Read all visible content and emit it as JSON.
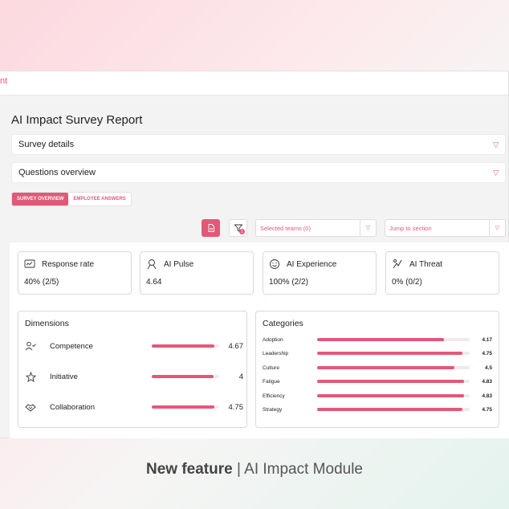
{
  "app": {
    "logo_text": "nt",
    "title": "AI Impact Survey Report"
  },
  "accordions": [
    {
      "label": "Survey details"
    },
    {
      "label": "Questions overview"
    }
  ],
  "tabs": [
    {
      "label": "SURVEY OVERVIEW",
      "active": true
    },
    {
      "label": "EMPLOYEE ANSWERS",
      "active": false
    }
  ],
  "toolbar": {
    "filter_badge": "1",
    "teams_select": "Selected teams (0)",
    "jump_select": "Jump to section"
  },
  "kpis": [
    {
      "label": "Response rate",
      "value": "40% (2/5)",
      "icon": "response-rate-icon"
    },
    {
      "label": "AI Pulse",
      "value": "4.64",
      "icon": "ai-pulse-icon"
    },
    {
      "label": "AI Experience",
      "value": "100% (2/2)",
      "icon": "smiley-icon"
    },
    {
      "label": "AI Threat",
      "value": "0% (0/2)",
      "icon": "ai-threat-icon"
    }
  ],
  "dimensions": {
    "title": "Dimensions",
    "items": [
      {
        "label": "Competence",
        "value": "4.67",
        "fraction": 0.93,
        "icon": "competence-icon"
      },
      {
        "label": "Initiative",
        "value": "4",
        "fraction": 0.92,
        "icon": "star-icon"
      },
      {
        "label": "Collaboration",
        "value": "4.75",
        "fraction": 0.93,
        "icon": "handshake-icon"
      }
    ]
  },
  "categories": {
    "title": "Categories",
    "items": [
      {
        "label": "Adoption",
        "value": "4.17",
        "fraction": 0.83
      },
      {
        "label": "Leadership",
        "value": "4.75",
        "fraction": 0.95
      },
      {
        "label": "Culture",
        "value": "4.5",
        "fraction": 0.9
      },
      {
        "label": "Fatigue",
        "value": "4.83",
        "fraction": 0.965
      },
      {
        "label": "Efficiency",
        "value": "4.83",
        "fraction": 0.965
      },
      {
        "label": "Strategy",
        "value": "4.75",
        "fraction": 0.95
      }
    ]
  },
  "footer": {
    "bold": "New feature",
    "separator": "|",
    "rest": "AI Impact Module"
  },
  "colors": {
    "accent": "#e05a78",
    "track": "#f1e9ea"
  }
}
